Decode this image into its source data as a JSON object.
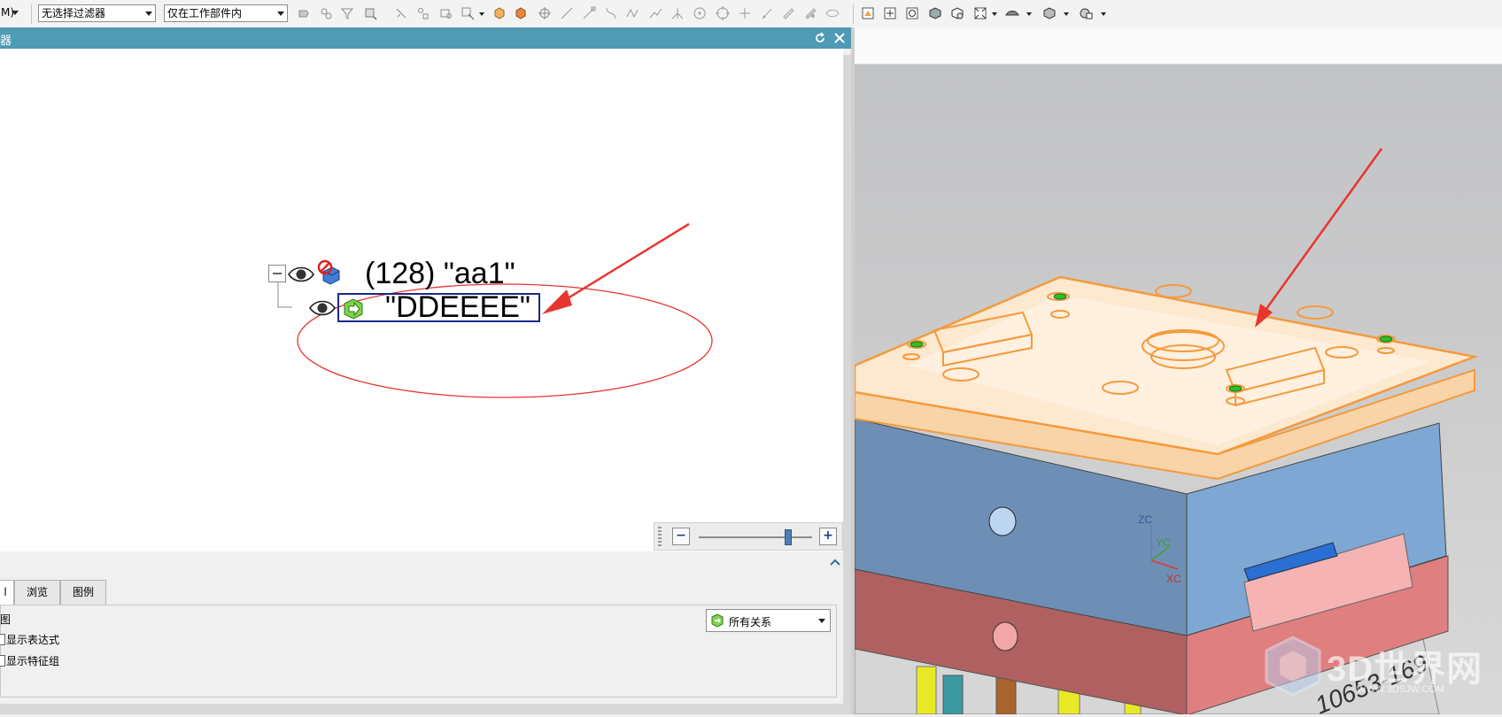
{
  "toolbar": {
    "left_cutoff_label": "M)",
    "filter_select": "无选择过滤器",
    "scope_select": "仅在工作部件内"
  },
  "navigator": {
    "title_fragment": "器",
    "tree": {
      "root_label": "(128) \"aa1\"",
      "child_label": "\"DDEEEE\""
    },
    "zoom": {
      "minus": "−",
      "plus": "+",
      "level": 0.8
    },
    "tabs": [
      {
        "label": "l"
      },
      {
        "label": "浏览"
      },
      {
        "label": "图例"
      }
    ],
    "options": {
      "view_label": "视图",
      "show_expressions": "显示表达式",
      "show_feature_groups": "显示特征组",
      "relation_select": "所有关系"
    }
  },
  "viewport": {
    "triad": {
      "zc": "ZC",
      "yc": "YC",
      "xc": "XC"
    },
    "engraving": "10653-169",
    "watermark_brand": "3D世界网",
    "watermark_url": "WWW.3DSJW.COM"
  },
  "colors": {
    "title_bar": "#4f9ab5",
    "selection_orange": "#f49a3c",
    "annotation_red": "#e8352f",
    "mold_blue": "#7ea7d3",
    "mold_pink": "#e07f7f"
  }
}
